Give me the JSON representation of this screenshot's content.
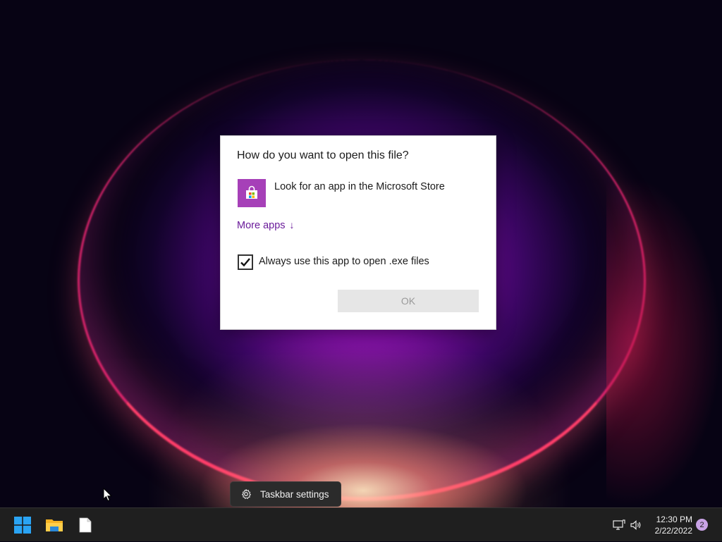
{
  "dialog": {
    "title": "How do you want to open this file?",
    "store_option": "Look for an app in the Microsoft Store",
    "more_apps": "More apps",
    "more_apps_arrow": "↓",
    "checkbox_label": "Always use this app to open .exe files",
    "checkbox_checked": true,
    "ok_button": "OK"
  },
  "tooltip": {
    "label": "Taskbar settings"
  },
  "taskbar": {
    "pinned": [
      "start-icon",
      "file-explorer-icon",
      "blank-document-icon"
    ],
    "tray": {
      "time": "12:30 PM",
      "date": "2/22/2022",
      "notification_count": "2"
    }
  },
  "colors": {
    "accent_link": "#6a1b9a",
    "store_tile": "#a640b8",
    "taskbar_bg": "#1f1f1f"
  }
}
